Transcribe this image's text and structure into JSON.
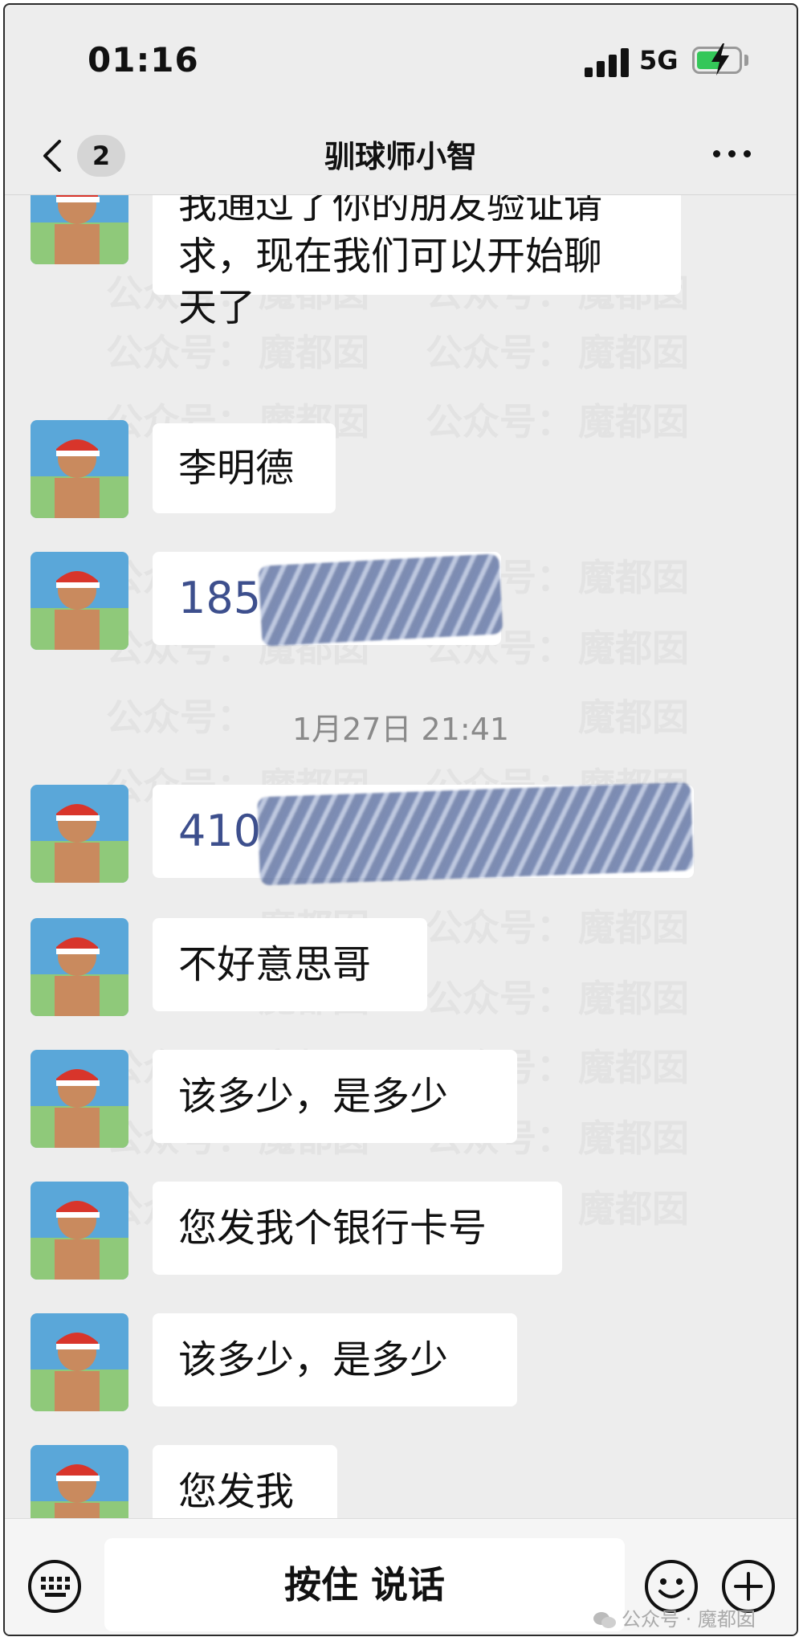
{
  "status_bar": {
    "time": "01:16",
    "network": "5G",
    "battery_level": 0.6,
    "icons": [
      "signal-icon",
      "battery-charging-icon"
    ]
  },
  "nav": {
    "unread_count": "2",
    "title": "驯球师小智",
    "icons": [
      "chevron-left-icon",
      "more-icon"
    ]
  },
  "messages": [
    {
      "type": "text",
      "text": "我通过了你的朋友验证请求，现在我们可以开始聊天了",
      "lines": [
        "我通过了你的朋友验证请",
        "求，现在我们可以开始聊",
        "天了"
      ]
    },
    {
      "type": "text",
      "text": "李明德"
    },
    {
      "type": "redacted",
      "visible_text": "185"
    },
    {
      "type": "redacted",
      "visible_text": "410"
    },
    {
      "type": "text",
      "text": "不好意思哥"
    },
    {
      "type": "text",
      "text": "该多少，是多少"
    },
    {
      "type": "text",
      "text": "您发我个银行卡号"
    },
    {
      "type": "text",
      "text": "该多少，是多少"
    },
    {
      "type": "text",
      "text": "您发我"
    }
  ],
  "timestamp": "1月27日 21:41",
  "watermark": {
    "left": "公众号：",
    "right": "魔都囡"
  },
  "input_bar": {
    "hold_to_talk_label": "按住 说话",
    "icons": [
      "keyboard-icon",
      "emoji-icon",
      "plus-icon"
    ]
  },
  "source_watermark": "公众号 · 魔都囡",
  "colors": {
    "background": "#ededed",
    "bubble": "#ffffff",
    "redacted_text": "#3d4f8d",
    "battery": "#34c759"
  }
}
